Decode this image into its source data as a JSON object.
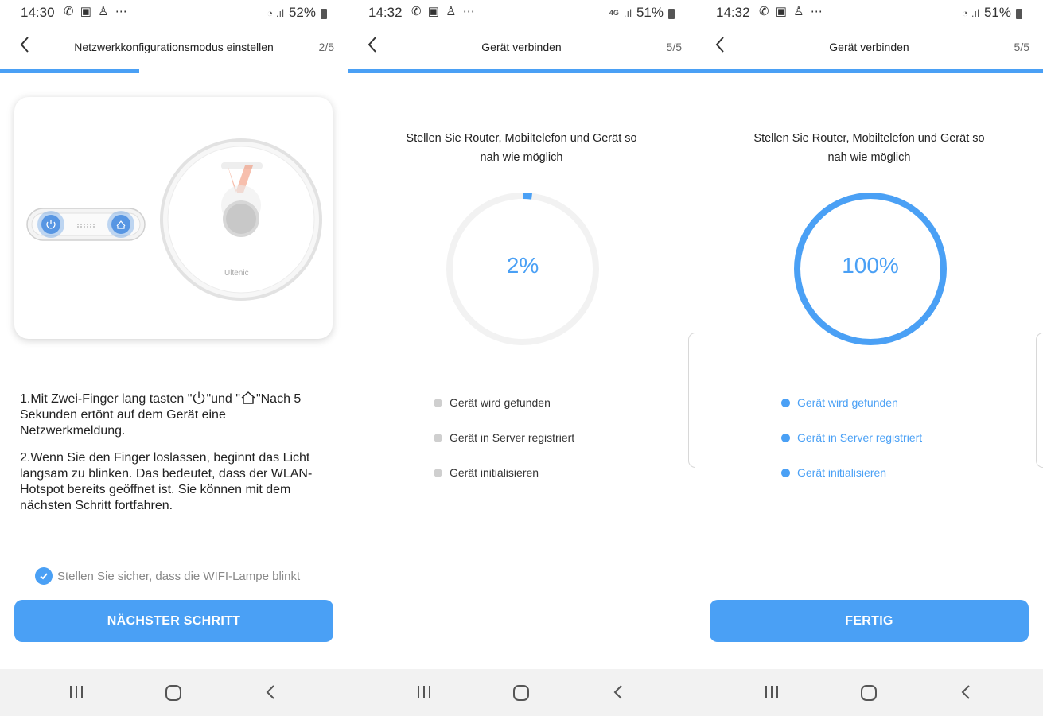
{
  "colors": {
    "accent": "#4aa0f5",
    "inactive_dot": "#cfcfcf",
    "nav_bg": "#f2f2f2"
  },
  "screens": [
    {
      "status": {
        "time": "14:30",
        "battery": "52%"
      },
      "nav": {
        "title": "Netzwerkkonfigurationsmodus einstellen",
        "step": "2/5"
      },
      "progress_fraction": 0.4,
      "device_brand": "Ultenic",
      "instructions": [
        {
          "pre": "1.Mit Zwei-Finger lang tasten \"",
          "mid": "\"und \"",
          "post": "\"Nach 5 Sekunden ertönt auf dem Gerät eine Netzwerkmeldung."
        },
        {
          "text": "2.Wenn Sie den Finger loslassen, beginnt das Licht langsam zu blinken. Das bedeutet, dass der WLAN-Hotspot bereits geöffnet ist. Sie können mit dem nächsten Schritt fortfahren."
        }
      ],
      "confirm_label": "Stellen Sie sicher, dass die WIFI-Lampe blinkt",
      "button_label": "NÄCHSTER SCHRITT"
    },
    {
      "status": {
        "time": "14:32",
        "battery": "51%",
        "network": "4G"
      },
      "nav": {
        "title": "Gerät verbinden",
        "step": "5/5"
      },
      "progress_fraction": 1.0,
      "hint_line1": "Stellen Sie Router, Mobiltelefon und Gerät so",
      "hint_line2": "nah wie möglich",
      "percent_value": 2,
      "percent_label": "2%",
      "steps": [
        {
          "label": "Gerät wird gefunden",
          "done": false
        },
        {
          "label": "Gerät in Server registriert",
          "done": false
        },
        {
          "label": "Gerät initialisieren",
          "done": false
        }
      ]
    },
    {
      "status": {
        "time": "14:32",
        "battery": "51%"
      },
      "nav": {
        "title": "Gerät verbinden",
        "step": "5/5"
      },
      "progress_fraction": 1.0,
      "hint_line1": "Stellen Sie Router, Mobiltelefon und Gerät so",
      "hint_line2": "nah wie möglich",
      "percent_value": 100,
      "percent_label": "100%",
      "steps": [
        {
          "label": "Gerät wird gefunden",
          "done": true
        },
        {
          "label": "Gerät in Server registriert",
          "done": true
        },
        {
          "label": "Gerät initialisieren",
          "done": true
        }
      ],
      "button_label": "FERTIG"
    }
  ]
}
